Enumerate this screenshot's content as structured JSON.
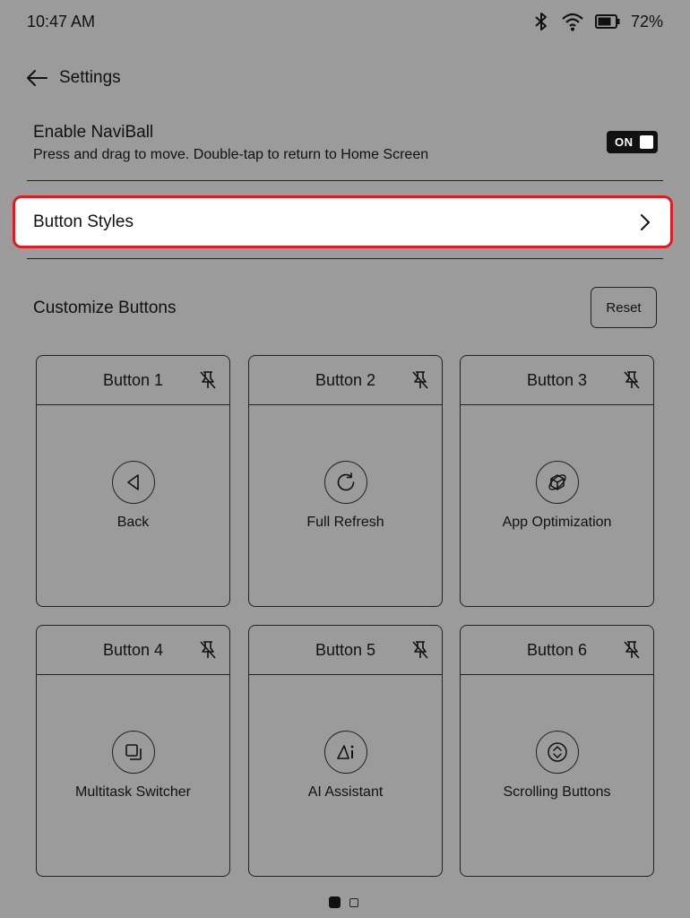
{
  "status_bar": {
    "time": "10:47 AM",
    "battery": "72%"
  },
  "header": {
    "title": "Settings"
  },
  "naviball": {
    "title": "Enable NaviBall",
    "description": "Press and drag to move. Double-tap to return to Home Screen",
    "toggle_label": "ON"
  },
  "button_styles": {
    "label": "Button Styles"
  },
  "customize": {
    "title": "Customize Buttons",
    "reset_label": "Reset"
  },
  "buttons": [
    {
      "title": "Button 1",
      "function": "Back",
      "icon": "back-triangle-icon"
    },
    {
      "title": "Button 2",
      "function": "Full Refresh",
      "icon": "refresh-icon"
    },
    {
      "title": "Button 3",
      "function": "App Optimization",
      "icon": "cube-optimization-icon"
    },
    {
      "title": "Button 4",
      "function": "Multitask Switcher",
      "icon": "multitask-icon"
    },
    {
      "title": "Button 5",
      "function": "AI Assistant",
      "icon": "ai-assistant-icon"
    },
    {
      "title": "Button 6",
      "function": "Scrolling Buttons",
      "icon": "scroll-updown-icon"
    }
  ],
  "pager": {
    "pages": 2,
    "current": 1
  },
  "colors": {
    "background": "#9b9b9b",
    "highlight_border": "#e21b23"
  }
}
